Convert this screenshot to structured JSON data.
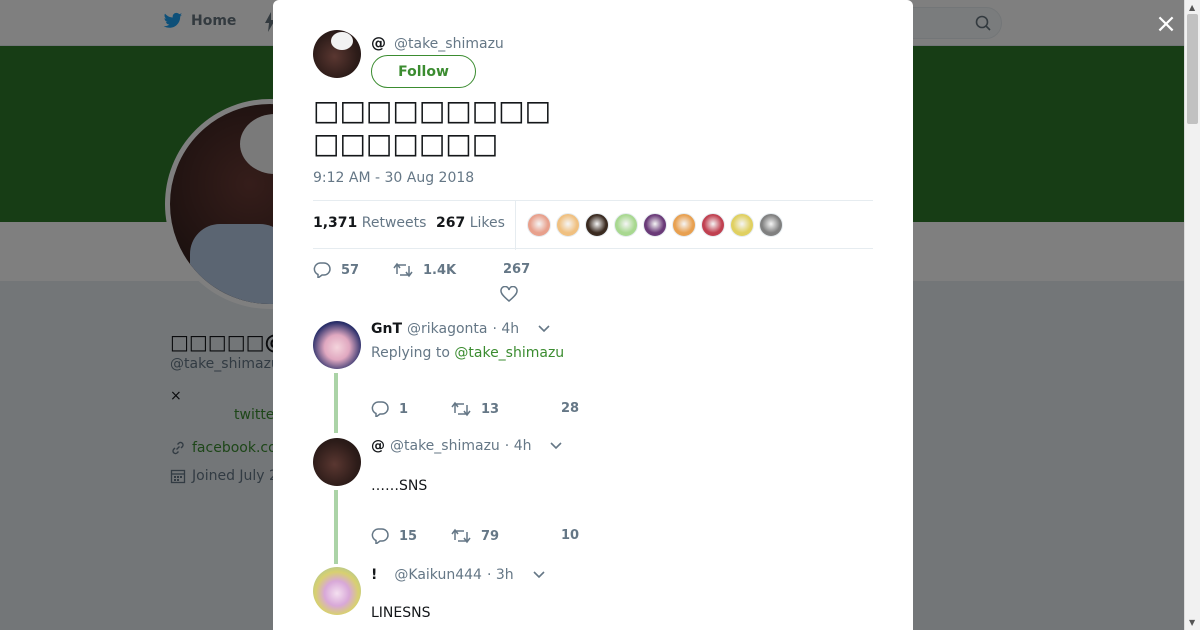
{
  "background": {
    "nav_home": "Home",
    "profile_name": "□□□□□@□□□",
    "profile_handle": "@take_shimazu",
    "bio_x": "×",
    "bio_link": "twitte",
    "website": "facebook.co",
    "joined": "Joined July 2"
  },
  "modal": {
    "close_label": "×",
    "author": {
      "name": "@",
      "handle": "@take_shimazu"
    },
    "follow_label": "Follow",
    "tweet_text": "□□□□□□□□□\n□□□□□□□",
    "timestamp": "9:12 AM - 30 Aug 2018",
    "stats": {
      "retweets_count": "1,371",
      "retweets_label": "Retweets",
      "likes_count": "267",
      "likes_label": "Likes"
    },
    "liker_colors": [
      "#e8a08c",
      "#f0c080",
      "#3a2a20",
      "#a8d890",
      "#6a3a78",
      "#e8a050",
      "#c04050",
      "#e0d060",
      "#808080"
    ],
    "actions": {
      "replies": "57",
      "retweets": "1.4K",
      "likes": "267"
    }
  },
  "replies": [
    {
      "name": "GnT",
      "handle": "@rikagonta",
      "time": "· 4h",
      "replying_prefix": "Replying to",
      "replying_to": "@take_shimazu",
      "body": "",
      "replies": "1",
      "retweets": "13",
      "likes": "28"
    },
    {
      "name": "@",
      "handle": "@take_shimazu",
      "time": "· 4h",
      "body": "……SNS",
      "replies": "15",
      "retweets": "79",
      "likes": "10"
    },
    {
      "name": "!",
      "handle": "@Kaikun444",
      "time": "· 3h",
      "body": "LINESNS"
    }
  ],
  "colors": {
    "accent": "#3b8c30",
    "banner": "#2e7a2a"
  }
}
